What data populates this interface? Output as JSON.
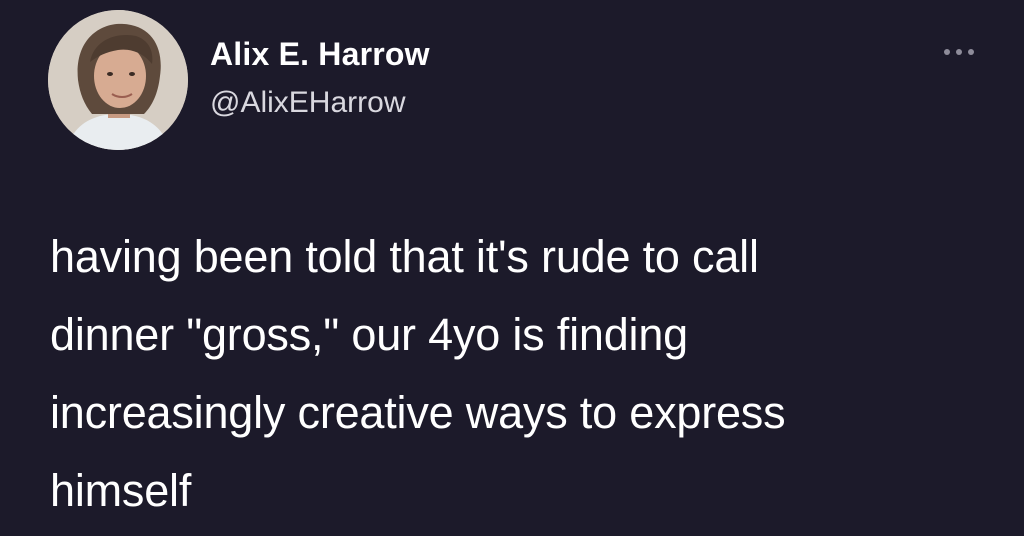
{
  "author": {
    "display_name": "Alix E. Harrow",
    "handle": "@AlixEHarrow",
    "avatar_icon": "profile-photo"
  },
  "actions": {
    "more_icon": "ellipsis-icon"
  },
  "tweet": {
    "text": "having been told that it's rude to call\ndinner \"gross,\" our 4yo is finding\nincreasingly creative ways to express\nhimself"
  },
  "colors": {
    "background": "#1c1a2a",
    "text": "#ffffff",
    "handle": "#d9d8df"
  }
}
